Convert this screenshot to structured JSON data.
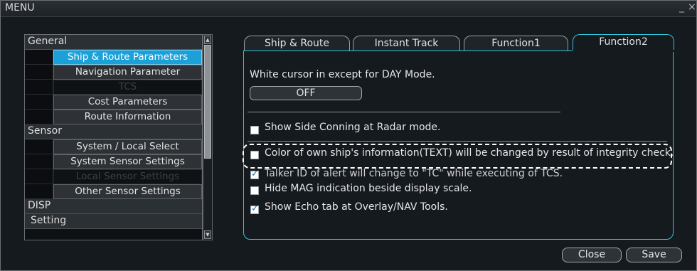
{
  "window": {
    "title": "MENU",
    "minimize_label": "_",
    "close_label": "×"
  },
  "menu": {
    "categories": {
      "general": "General",
      "sensor": "Sensor",
      "disp": "DISP",
      "setting": "Setting"
    },
    "items": {
      "ship_route_parameters": "Ship & Route Parameters",
      "navigation_parameter": "Navigation Parameter",
      "tcs": "TCS",
      "cost_parameters": "Cost Parameters",
      "route_information": "Route Information",
      "system_local_select": "System / Local Select",
      "system_sensor_settings": "System Sensor Settings",
      "local_sensor_settings": "Local Sensor Settings",
      "other_sensor_settings": "Other Sensor Settings"
    },
    "selected": "Ship & Route Parameters"
  },
  "tabs": [
    "Ship & Route",
    "Instant Track",
    "Function1",
    "Function2"
  ],
  "active_tab": "Function2",
  "function2": {
    "cursor_label": "White cursor in except for DAY Mode.",
    "cursor_value": "OFF",
    "options": [
      {
        "label": "Show Side Conning at Radar mode.",
        "checked": false
      },
      {
        "label": "Color of own ship's information(TEXT) will be changed by result of integrity check.",
        "checked": false
      },
      {
        "label": "Talker ID of alert will change to \"TC\" while executing of TCS.",
        "checked": true
      },
      {
        "label": "Hide MAG indication beside display scale.",
        "checked": false
      },
      {
        "label": "Show Echo tab at Overlay/NAV Tools.",
        "checked": true
      }
    ]
  },
  "buttons": {
    "close": "Close",
    "save": "Save"
  },
  "colors": {
    "accent": "#31c6d9",
    "selected_item": "#1ba0d8",
    "highlight_border": "#ffffff"
  }
}
